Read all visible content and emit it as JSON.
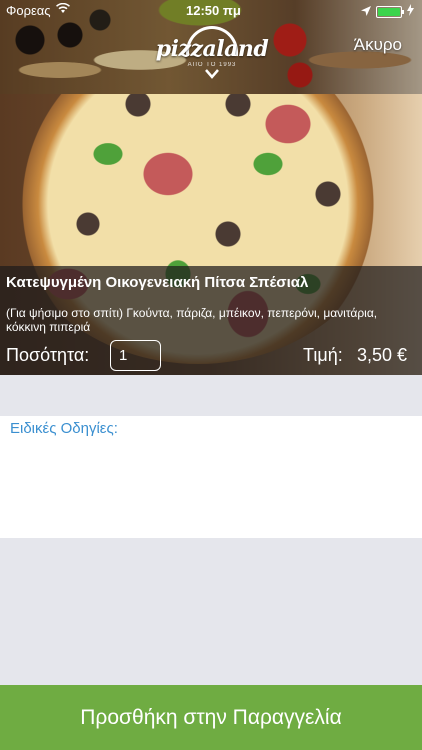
{
  "status_bar": {
    "carrier": "Φορεας",
    "time": "12:50 πμ"
  },
  "header": {
    "logo_text": "pizzaland",
    "logo_subtitle": "ΑΠΟ ΤΟ 1993",
    "cancel_label": "Άκυρο"
  },
  "product": {
    "name": "Κατεψυγμένη Οικογενειακή Πίτσα Σπέσιαλ",
    "description": "(Για ψήσιμο στο σπίτι) Γκούντα, πάριζα, μπέικον, πεπερόνι, μανιτάρια, κόκκινη πιπεριά",
    "quantity_label": "Ποσότητα:",
    "quantity_value": "1",
    "price_label": "Τιμή:",
    "price_value": "3,50 €"
  },
  "instructions": {
    "label": "Ειδικές Οδηγίες:",
    "value": ""
  },
  "footer": {
    "add_button_label": "Προσθήκη στην Παραγγελία"
  },
  "colors": {
    "accent_green": "#6fac42",
    "label_blue": "#3a8fd0",
    "battery_green": "#3bd44c"
  },
  "icons": [
    "wifi-icon",
    "location-arrow-icon",
    "battery-icon",
    "charging-bolt-icon"
  ]
}
